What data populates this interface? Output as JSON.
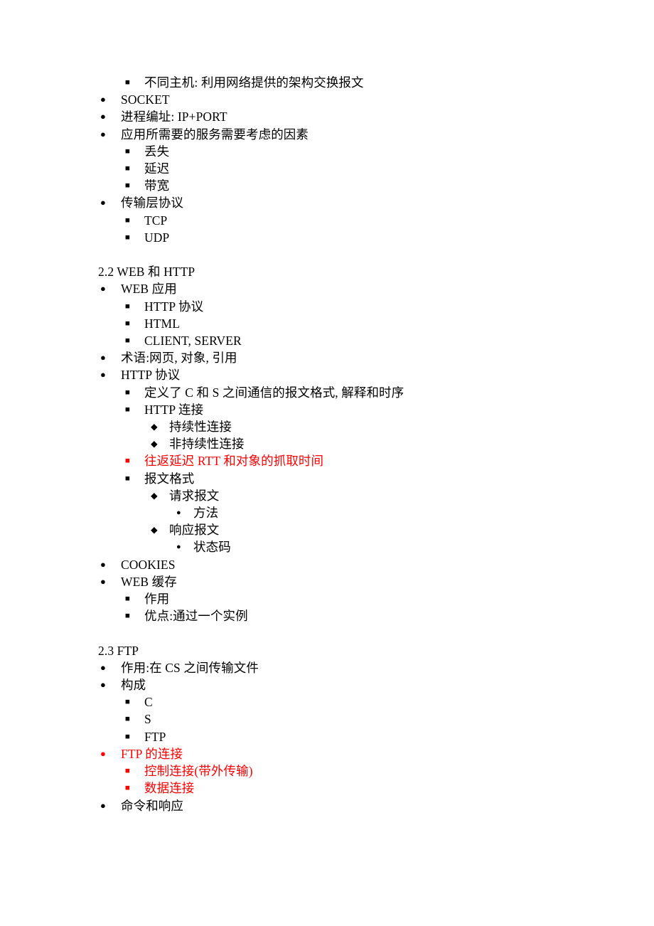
{
  "document": {
    "page_bg": "#ffffff",
    "text_color": "#000000",
    "highlight_color": "#ff0000",
    "bullets": {
      "level1": "●",
      "level2": "■",
      "level3": "◆",
      "level4": "●"
    },
    "blocks": [
      {
        "id": "block-section-21-tail",
        "items": [
          {
            "level": 2,
            "text": "不同主机: 利用网络提供的架构交换报文",
            "color": "black"
          },
          {
            "level": 1,
            "text": "SOCKET",
            "color": "black"
          },
          {
            "level": 1,
            "text": "进程编址: IP+PORT",
            "color": "black"
          },
          {
            "level": 1,
            "text": "应用所需要的服务需要考虑的因素",
            "color": "black"
          },
          {
            "level": 2,
            "text": "丢失",
            "color": "black"
          },
          {
            "level": 2,
            "text": "延迟",
            "color": "black"
          },
          {
            "level": 2,
            "text": "带宽",
            "color": "black"
          },
          {
            "level": 1,
            "text": "传输层协议",
            "color": "black"
          },
          {
            "level": 2,
            "text": "TCP",
            "color": "black"
          },
          {
            "level": 2,
            "text": "UDP",
            "color": "black"
          }
        ]
      },
      {
        "id": "block-section-22",
        "heading": "2.2 WEB 和 HTTP",
        "items": [
          {
            "level": 1,
            "text": "WEB 应用",
            "color": "black"
          },
          {
            "level": 2,
            "text": "HTTP 协议",
            "color": "black"
          },
          {
            "level": 2,
            "text": "HTML",
            "color": "black"
          },
          {
            "level": 2,
            "text": "CLIENT, SERVER",
            "color": "black"
          },
          {
            "level": 1,
            "text": "术语:网页, 对象, 引用",
            "color": "black"
          },
          {
            "level": 1,
            "text": "HTTP 协议",
            "color": "black"
          },
          {
            "level": 2,
            "text": "定义了 C 和 S 之间通信的报文格式, 解释和时序",
            "color": "black"
          },
          {
            "level": 2,
            "text": "HTTP 连接",
            "color": "black"
          },
          {
            "level": 3,
            "text": "持续性连接",
            "color": "black"
          },
          {
            "level": 3,
            "text": "非持续性连接",
            "color": "black"
          },
          {
            "level": 2,
            "text": "往返延迟 RTT 和对象的抓取时间",
            "color": "red"
          },
          {
            "level": 2,
            "text": "报文格式",
            "color": "black"
          },
          {
            "level": 3,
            "text": "请求报文",
            "color": "black"
          },
          {
            "level": 4,
            "text": "方法",
            "color": "black"
          },
          {
            "level": 3,
            "text": "响应报文",
            "color": "black"
          },
          {
            "level": 4,
            "text": "状态码",
            "color": "black"
          },
          {
            "level": 1,
            "text": "COOKIES",
            "color": "black"
          },
          {
            "level": 1,
            "text": "WEB 缓存",
            "color": "black"
          },
          {
            "level": 2,
            "text": "作用",
            "color": "black"
          },
          {
            "level": 2,
            "text": "优点:通过一个实例",
            "color": "black"
          }
        ]
      },
      {
        "id": "block-section-23",
        "heading": "2.3 FTP",
        "items": [
          {
            "level": 1,
            "text": "作用:在 CS 之间传输文件",
            "color": "black"
          },
          {
            "level": 1,
            "text": "构成",
            "color": "black"
          },
          {
            "level": 2,
            "text": "C",
            "color": "black"
          },
          {
            "level": 2,
            "text": "S",
            "color": "black"
          },
          {
            "level": 2,
            "text": "FTP",
            "color": "black"
          },
          {
            "level": 1,
            "text": "FTP 的连接",
            "color": "red"
          },
          {
            "level": 2,
            "text": "控制连接(带外传输)",
            "color": "red"
          },
          {
            "level": 2,
            "text": "数据连接",
            "color": "red"
          },
          {
            "level": 1,
            "text": "命令和响应",
            "color": "black"
          }
        ]
      }
    ]
  }
}
